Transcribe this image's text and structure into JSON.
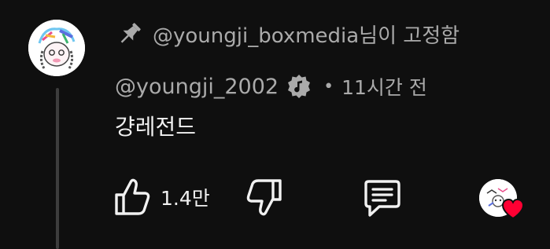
{
  "pinned": {
    "icon": "pin-icon",
    "text": "@youngji_boxmedia님이 고정함"
  },
  "comment": {
    "author": "@youngji_2002",
    "badge_icon": "music-note-badge-icon",
    "separator": "•",
    "time": "11시간 전",
    "text": "걍레전드"
  },
  "actions": {
    "like_count": "1.4만",
    "like_icon": "thumb-up-icon",
    "dislike_icon": "thumb-down-icon",
    "reply_icon": "reply-comment-icon",
    "creator_heart_icon": "heart-icon"
  },
  "colors": {
    "background": "#0f0f0f",
    "primary_text": "#f1f1f1",
    "secondary_text": "#aaaaaa",
    "heart": "#ff0033"
  }
}
